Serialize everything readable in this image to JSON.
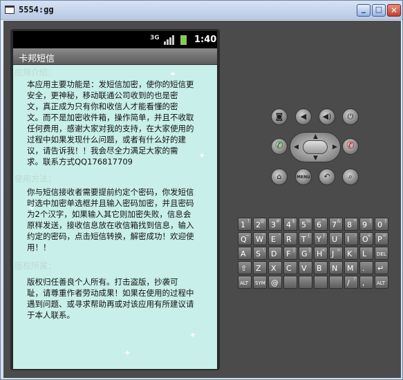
{
  "window": {
    "title": "5554:gg"
  },
  "statusbar": {
    "network": "3G",
    "time": "1:40"
  },
  "app": {
    "title": "卡邦短信"
  },
  "sections": [
    {
      "heading": "应用介绍：",
      "lines": [
        "本应用主要功能是：发短信加密，使你的短信更",
        "安全，更神秘，移动联通公司收到的也是密",
        "文，真正成为只有你和收信人才能看懂的密",
        "文。而不是加密收件箱，操作简单，并且不收取",
        "任何费用，感谢大家对我的支持，在大家使用的",
        "过程中如果发现什么问题，或者有什么好的建",
        "议，请告诉我！！我会尽全力满足大家的需",
        "求。联系方式QQ176817709"
      ]
    },
    {
      "heading": "使用方法：",
      "lines": [
        "你与短信接收者需要提前约定个密码，你发短信",
        "时选中加密单选框并且输入密码加密，并且密码",
        "为2个汉字，如果输入其它则加密失败，信息会",
        "原样发送，接收信息放在收信箱找到信息，输入",
        "约定的密码，点击短信转换，解密成功！欢迎使",
        "用！！"
      ]
    },
    {
      "heading": "版权所属：",
      "lines": [
        "版权归任善良个人所有。打击盗版，抄袭可",
        "耻，请尊重作者劳动成果！如果在使用的过程中",
        "遇到问题、或寻求帮助再或对该应用有所建议请",
        "于本人联系。"
      ]
    }
  ],
  "controls": {
    "menu_label": "MENU"
  },
  "keyboard": {
    "rows": [
      [
        [
          "1",
          "!"
        ],
        [
          "2",
          "@"
        ],
        [
          "3",
          "#"
        ],
        [
          "4",
          "$"
        ],
        [
          "5",
          "%"
        ],
        [
          "6",
          "^"
        ],
        [
          "7",
          "&"
        ],
        [
          "8",
          "*"
        ],
        [
          "9",
          "("
        ],
        [
          "0",
          ")"
        ]
      ],
      [
        [
          "Q",
          "~"
        ],
        [
          "W",
          "\""
        ],
        [
          "E",
          "'"
        ],
        [
          "R",
          ""
        ],
        [
          "T",
          "{"
        ],
        [
          "Y",
          "}"
        ],
        [
          "U",
          "-"
        ],
        [
          "I",
          "-"
        ],
        [
          "O",
          "+"
        ],
        [
          "P",
          "="
        ]
      ],
      [
        [
          "A",
          ""
        ],
        [
          "S",
          "\\"
        ],
        [
          "D",
          ""
        ],
        [
          "F",
          "["
        ],
        [
          "G",
          "]"
        ],
        [
          "H",
          "<"
        ],
        [
          "J",
          ">"
        ],
        [
          "K",
          ";"
        ],
        [
          "L",
          ":"
        ],
        [
          "DEL",
          ""
        ]
      ],
      [
        [
          "⇧",
          ""
        ],
        [
          "Z",
          ""
        ],
        [
          "X",
          ""
        ],
        [
          "C",
          ""
        ],
        [
          "V",
          ""
        ],
        [
          "B",
          ""
        ],
        [
          "N",
          ""
        ],
        [
          "M",
          ""
        ],
        [
          ".",
          ""
        ],
        [
          "↵",
          ""
        ]
      ],
      [
        [
          "ALT",
          ""
        ],
        [
          "SYM",
          ""
        ],
        [
          "@",
          ""
        ],
        [
          "",
          ""
        ],
        [
          "",
          ""
        ],
        [
          "",
          ""
        ],
        [
          "",
          ""
        ],
        [
          "/",
          "?"
        ],
        [
          ",",
          ""
        ],
        [
          "ALT",
          ""
        ]
      ]
    ]
  }
}
